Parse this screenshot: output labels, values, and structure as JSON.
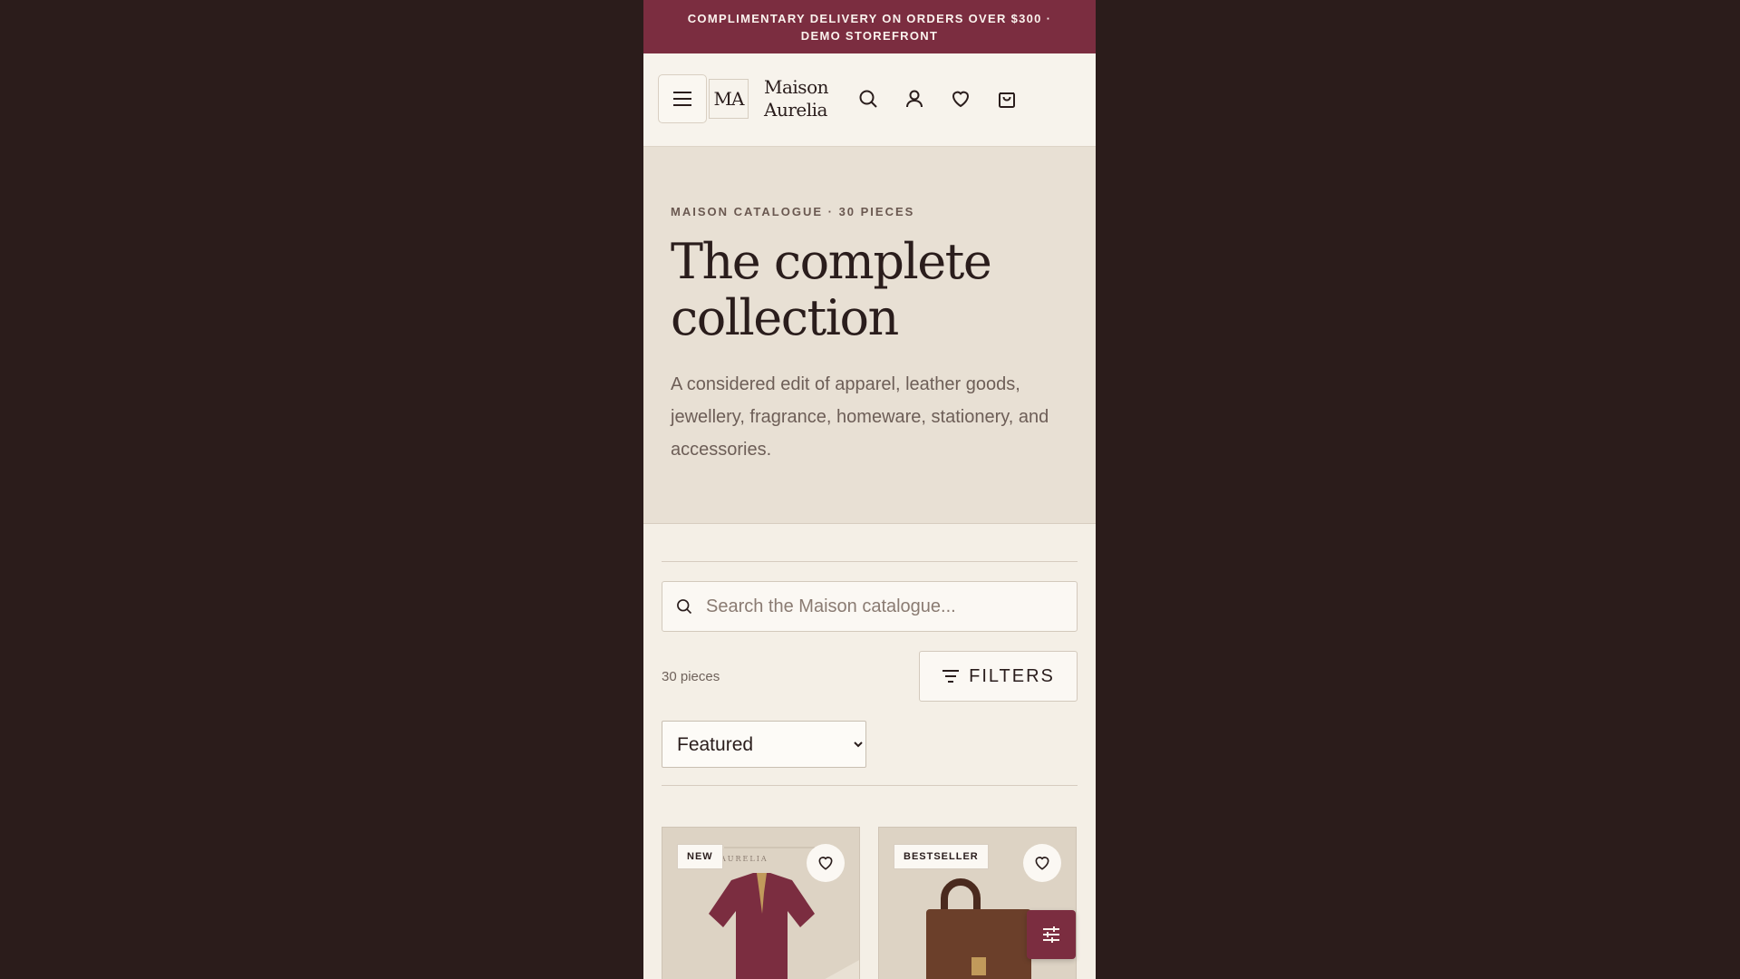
{
  "promo": {
    "line1": "COMPLIMENTARY DELIVERY ON ORDERS OVER $300 ·",
    "line2": "DEMO STOREFRONT"
  },
  "header": {
    "logo_mark": "MA",
    "brand_line1": "Maison",
    "brand_line2": "Aurelia",
    "icons": [
      "menu-icon",
      "search-icon",
      "account-icon",
      "heart-icon",
      "bag-icon"
    ]
  },
  "hero": {
    "eyebrow": "MAISON CATALOGUE · 30 PIECES",
    "title": "The complete collection",
    "description": "A considered edit of apparel, leather goods, jewellery, fragrance, homeware, stationery, and accessories."
  },
  "catalogue": {
    "search_placeholder": "Search the Maison catalogue...",
    "count": "30 pieces",
    "filters_label": "FILTERS",
    "sort_selected": "Featured"
  },
  "products": [
    {
      "badge": "NEW",
      "watermark": "AURELIA"
    },
    {
      "badge": "BESTSELLER"
    }
  ],
  "colors": {
    "accent": "#7b2d40",
    "page_bg": "#2b1c1b",
    "surface": "#f4efe6",
    "hero_bg": "#e8e0d4",
    "text": "#2a1d1c"
  }
}
